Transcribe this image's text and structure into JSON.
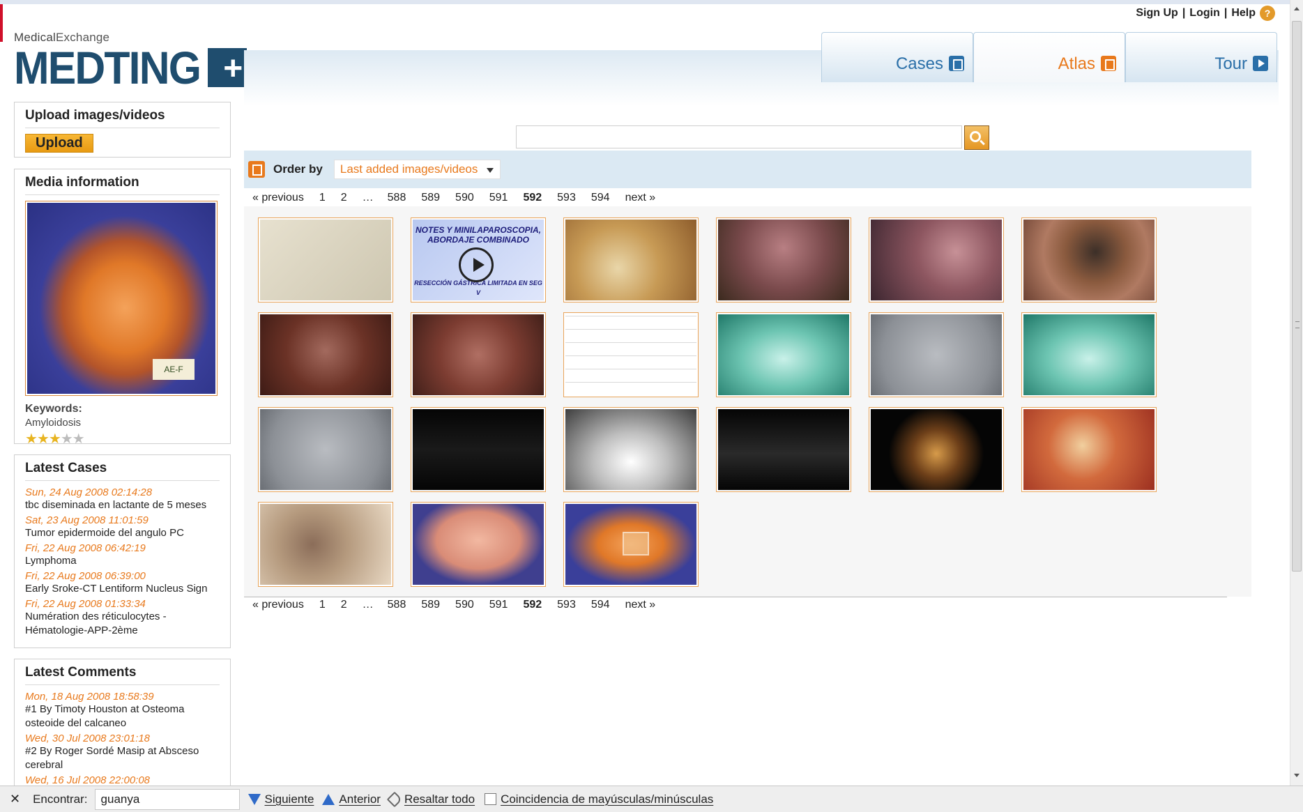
{
  "header": {
    "top_links": {
      "signup": "Sign Up",
      "sep1": "|",
      "login": "Login",
      "sep2": "|",
      "help": "Help",
      "help_icon": "?"
    },
    "logo": {
      "small_prefix": "Medical",
      "small_suffix": "Exchange",
      "main": "MEDTING",
      "plus": "+"
    },
    "tabs": [
      {
        "label": "Cases",
        "icon": "cases-icon"
      },
      {
        "label": "Atlas",
        "icon": "atlas-icon",
        "active": true
      },
      {
        "label": "Tour",
        "icon": "tour-play-icon"
      }
    ]
  },
  "sidebar": {
    "upload": {
      "title": "Upload images/videos",
      "button": "Upload"
    },
    "media": {
      "title": "Media information",
      "keywords_label": "Keywords:",
      "keywords": "Amyloidosis",
      "rating": 3,
      "rating_max": 5
    },
    "latest_cases": {
      "title": "Latest Cases",
      "items": [
        {
          "date": "Sun, 24 Aug 2008 02:14:28",
          "text": "tbc diseminada en lactante de 5 meses"
        },
        {
          "date": "Sat, 23 Aug 2008 11:01:59",
          "text": "Tumor epidermoide del angulo PC"
        },
        {
          "date": "Fri, 22 Aug 2008 06:42:19",
          "text": "Lymphoma"
        },
        {
          "date": "Fri, 22 Aug 2008 06:39:00",
          "text": "Early Sroke-CT Lentiform Nucleus Sign"
        },
        {
          "date": "Fri, 22 Aug 2008 01:33:34",
          "text": "Numération des réticulocytes - Hématologie-APP-2ème"
        }
      ]
    },
    "latest_comments": {
      "title": "Latest Comments",
      "items": [
        {
          "date": "Mon, 18 Aug 2008 18:58:39",
          "text": "#1 By Timoty Houston at Osteoma osteoide del calcaneo"
        },
        {
          "date": "Wed, 30 Jul 2008 23:01:18",
          "text": "#2 By Roger Sordé Masip at Absceso cerebral"
        },
        {
          "date": "Wed, 16 Jul 2008 22:00:08",
          "text": ""
        }
      ]
    }
  },
  "main": {
    "search": {
      "value": "",
      "placeholder": ""
    },
    "order": {
      "label": "Order by",
      "selected": "Last added images/videos"
    },
    "pager": {
      "previous": "« previous",
      "pages": [
        "1",
        "2",
        "…",
        "588",
        "589",
        "590",
        "591",
        "592",
        "593",
        "594"
      ],
      "current": "592",
      "next": "next »"
    },
    "gallery": [
      {
        "name": "drawing-anatomy",
        "bg": "linear-gradient(135deg,#e7e1cf,#cdc6b0)"
      },
      {
        "name": "video-laparoscopy-title",
        "bg": "linear-gradient(135deg,#b8c8f0,#dfe6fb)",
        "text": "NOTES Y MINILAPAROSCOPIA, ABORDAJE COMBINADO",
        "subtext": "RESECCIÓN GÁSTRICA LIMITADA EN SEG V",
        "video": true
      },
      {
        "name": "laparoscopy-yellow",
        "bg": "radial-gradient(circle at 40% 60%,#e9d6a9,#c79a55 45%,#8e5d2c)"
      },
      {
        "name": "endoscopy-pink",
        "bg": "radial-gradient(circle at 50% 35%,#b87f83,#7a4a4c 50%,#3b2a1e)"
      },
      {
        "name": "laparoscopy-instrument",
        "bg": "radial-gradient(circle at 65% 40%,#c79197,#8d5660 40%,#3c2630)"
      },
      {
        "name": "endoscopy-ring",
        "bg": "radial-gradient(circle at 55% 40%,#3c2f28,#8a5a3e 35%,#b07a62 60%,#6c4132)"
      },
      {
        "name": "endoscopy-red-1",
        "bg": "radial-gradient(circle at 50% 45%,#a36a5e,#6b3226 50%,#3d1b15)"
      },
      {
        "name": "endoscopy-blue-tool",
        "bg": "radial-gradient(circle at 50% 50%,#b06f63,#7c3c31 50%,#42201a)"
      },
      {
        "name": "ecg-trace",
        "bg": "repeating-linear-gradient(0deg,#ffffff 0 18px,#d9d9d9 18px 19px)"
      },
      {
        "name": "chest-xray-teal-1",
        "bg": "radial-gradient(ellipse at 50% 55%,#c9f1e9,#6dc5b2 45%,#1f7868)"
      },
      {
        "name": "microscopy-gray-1",
        "bg": "radial-gradient(circle at 50% 50%,#b9bcc1,#8c9096 70%,#6a6e74)"
      },
      {
        "name": "chest-xray-teal-2",
        "bg": "radial-gradient(ellipse at 50% 55%,#c9f1e9,#6dc5b2 45%,#1f7868)"
      },
      {
        "name": "microscopy-gray-2",
        "bg": "radial-gradient(circle at 50% 50%,#b9bcc1,#8c9096 70%,#6a6e74)"
      },
      {
        "name": "echo-doppler-1",
        "bg": "linear-gradient(180deg,#050505,#1a1a1a 50%,#050505)"
      },
      {
        "name": "chest-xray-bw",
        "bg": "radial-gradient(ellipse at 50% 65%,#ffffff,#bdbdbd 40%,#3e3e3e)"
      },
      {
        "name": "echo-doppler-2",
        "bg": "linear-gradient(180deg,#050505,#2a2a2a 55%,#050505)"
      },
      {
        "name": "echo-heart",
        "bg": "radial-gradient(circle at 50% 55%,#d79b4a,#6d3f19 30%,#050505 60%)"
      },
      {
        "name": "pathology-heart-valve",
        "bg": "radial-gradient(circle at 45% 45%,#f1cf9e,#d26a3d 40%,#9c2f20)"
      },
      {
        "name": "hand-photo",
        "bg": "radial-gradient(circle at 40% 50%,#8b6d59,#b59a7e 40%,#e8d8c3)"
      },
      {
        "name": "brain-slice",
        "bg": "radial-gradient(ellipse at 50% 45%,#f2b8a1,#d98c77 45%,#3f3f8f 70%)"
      },
      {
        "name": "heart-specimen-video",
        "bg": "radial-gradient(ellipse at 50% 50%,#f4a25a,#e07828 35%,#3a3f9a 70%)",
        "badge": true
      }
    ]
  },
  "findbar": {
    "close": "✕",
    "label": "Encontrar:",
    "value": "guanya",
    "next": "Siguiente",
    "prev": "Anterior",
    "highlight": "Resaltar todo",
    "match_case": "Coincidencia de mayúsculas/minúsculas"
  },
  "colors": {
    "accent": "#e8791c",
    "brand": "#1f4d6e",
    "tab_blue": "#2a6fa8",
    "date_orange": "#e8791c"
  }
}
